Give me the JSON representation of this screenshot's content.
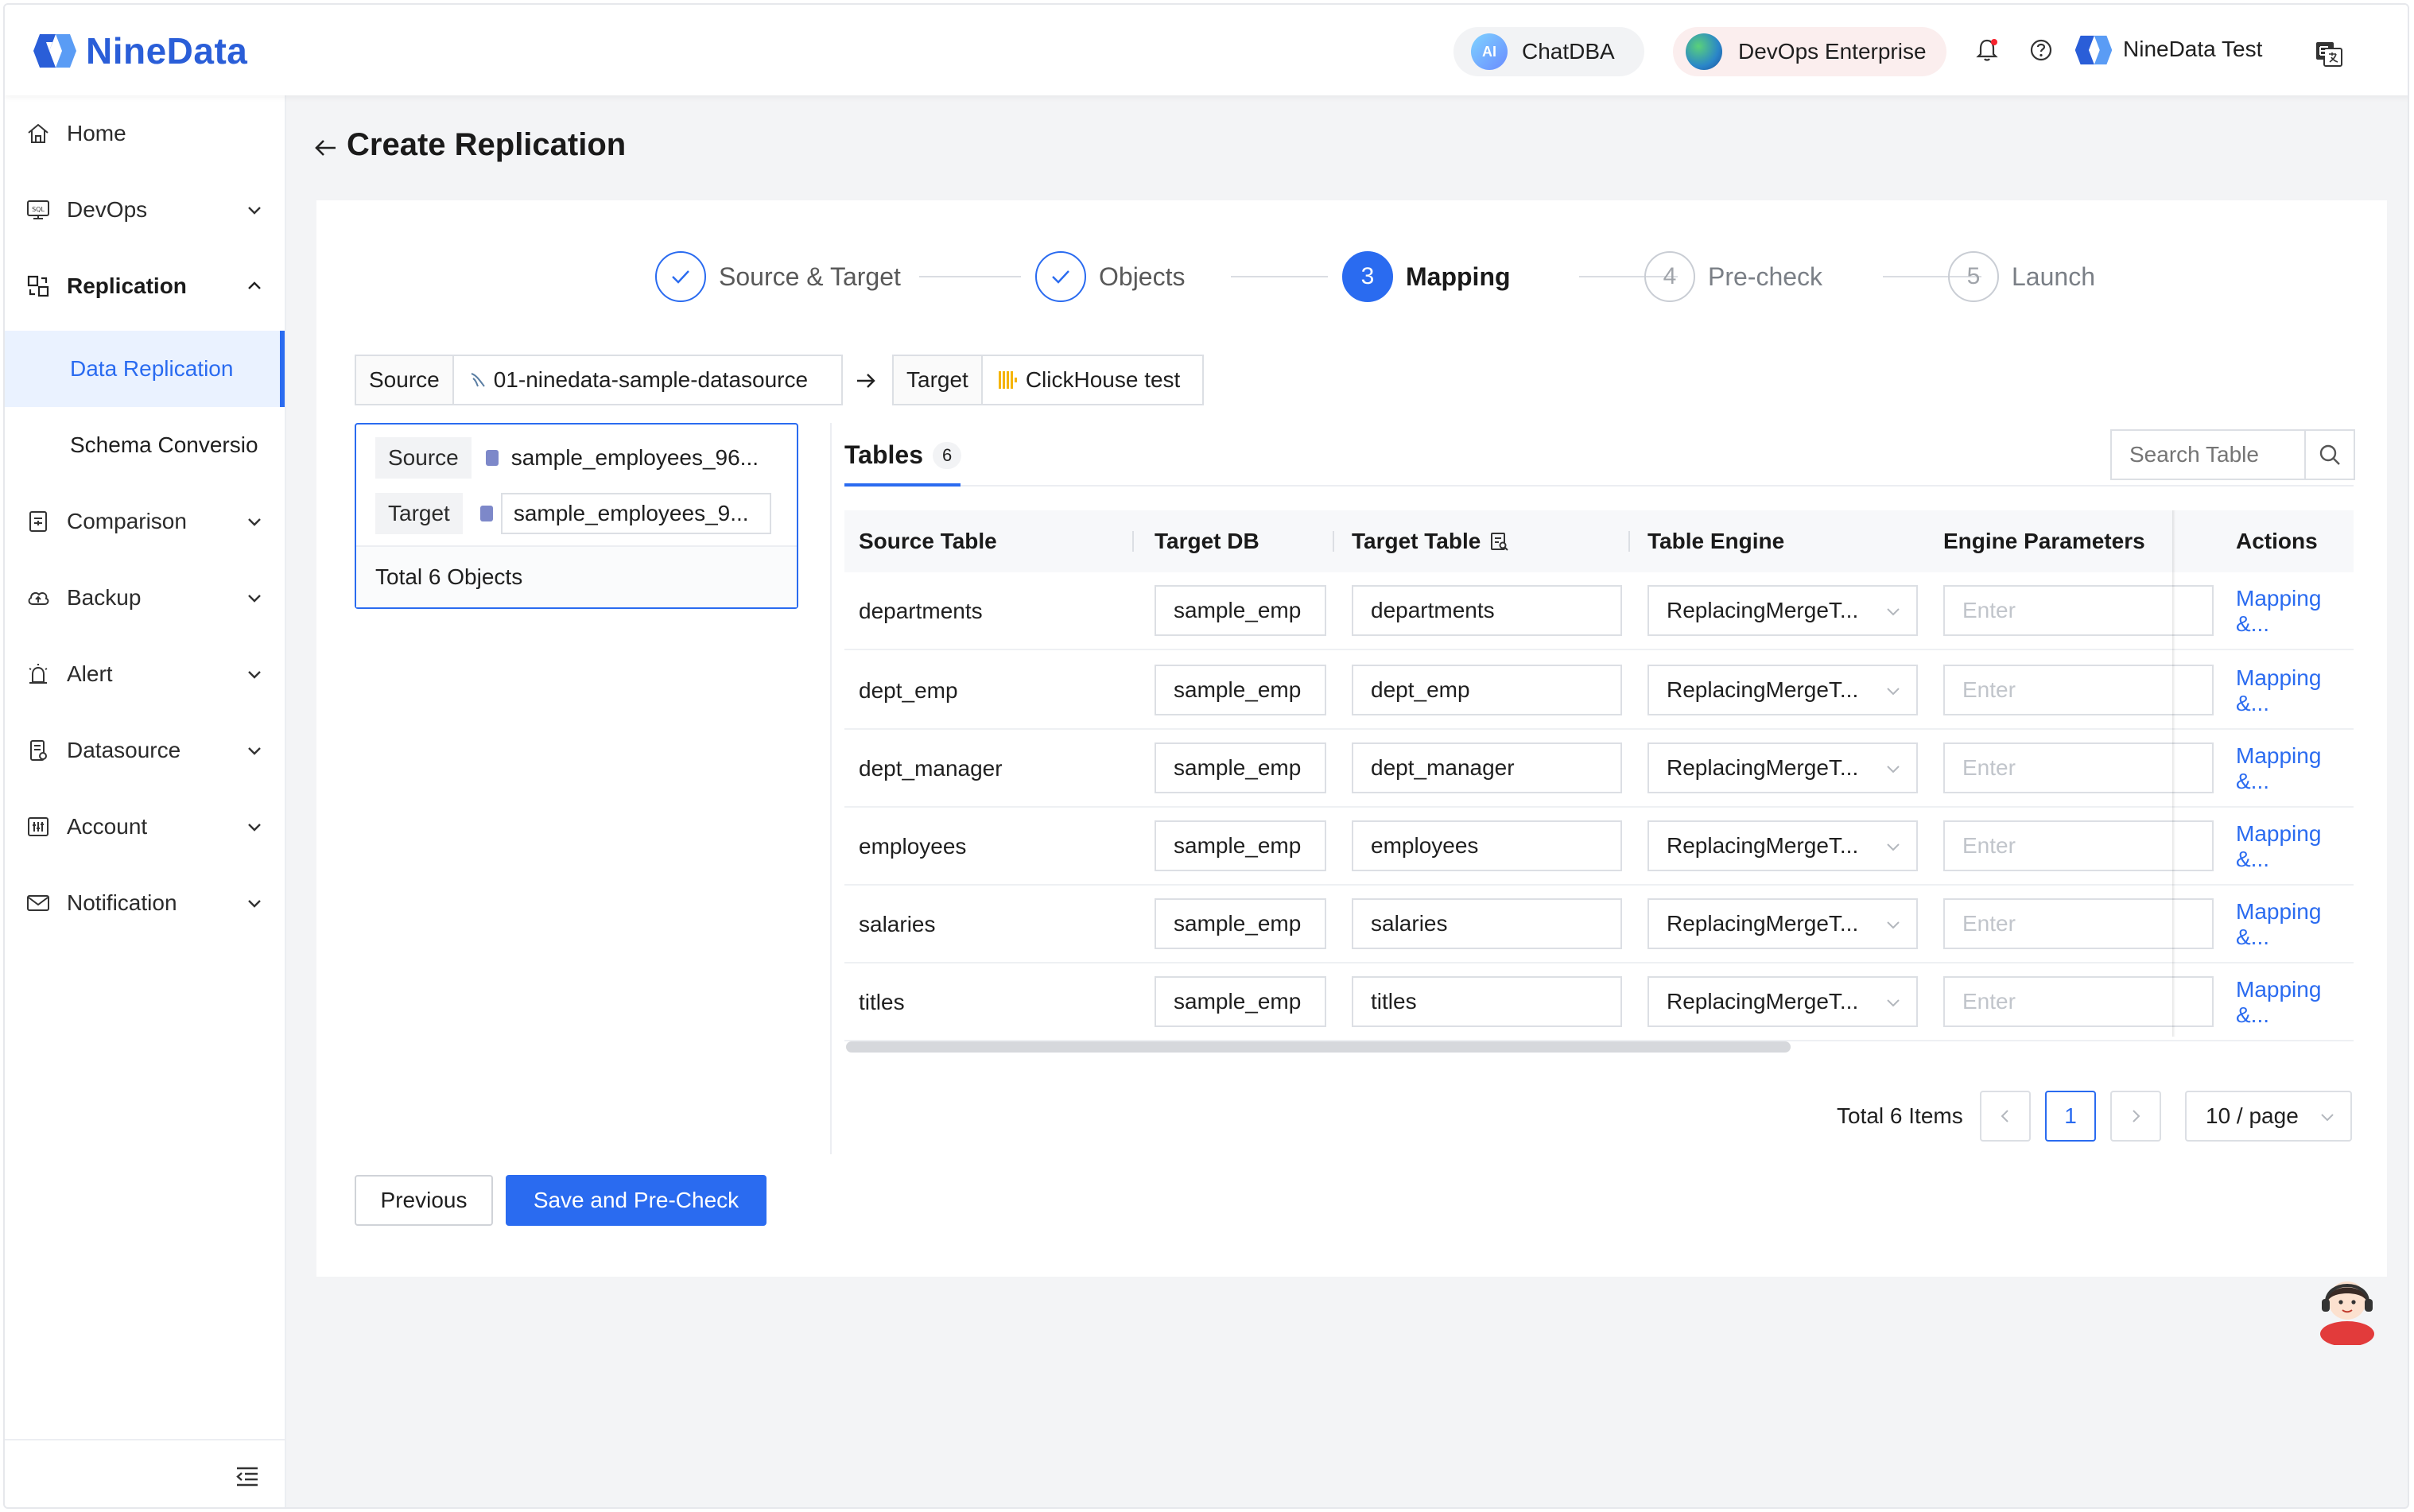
{
  "header": {
    "brand": "NineData",
    "chatdba_label": "ChatDBA",
    "ai_badge": "AI",
    "edition_label": "DevOps Enterprise",
    "user_name": "NineData Test"
  },
  "sidebar": {
    "items": [
      {
        "label": "Home",
        "icon": "home-icon"
      },
      {
        "label": "DevOps",
        "icon": "sql-icon"
      },
      {
        "label": "Replication",
        "icon": "replication-icon"
      },
      {
        "label": "Comparison",
        "icon": "comparison-icon"
      },
      {
        "label": "Backup",
        "icon": "backup-icon"
      },
      {
        "label": "Alert",
        "icon": "alert-icon"
      },
      {
        "label": "Datasource",
        "icon": "datasource-icon"
      },
      {
        "label": "Account",
        "icon": "account-icon"
      },
      {
        "label": "Notification",
        "icon": "mail-icon"
      }
    ],
    "sub_items": [
      "Data Replication",
      "Schema Conversio"
    ]
  },
  "page": {
    "title": "Create Replication"
  },
  "steps": [
    {
      "num": "",
      "label": "Source & Target",
      "state": "done"
    },
    {
      "num": "",
      "label": "Objects",
      "state": "done"
    },
    {
      "num": "3",
      "label": "Mapping",
      "state": "current"
    },
    {
      "num": "4",
      "label": "Pre-check",
      "state": "todo"
    },
    {
      "num": "5",
      "label": "Launch",
      "state": "todo"
    }
  ],
  "source_target": {
    "source_label": "Source",
    "source_value": "01-ninedata-sample-datasource",
    "target_label": "Target",
    "target_value": "ClickHouse test"
  },
  "objects_panel": {
    "source_label": "Source",
    "source_value": "sample_employees_96...",
    "target_label": "Target",
    "target_value": "sample_employees_9...",
    "total": "Total 6 Objects"
  },
  "tables_tab": {
    "label": "Tables",
    "count": "6",
    "search_placeholder": "Search Table"
  },
  "table": {
    "columns": [
      "Source Table",
      "Target DB",
      "Target Table",
      "Table Engine",
      "Engine Parameters",
      "Actions"
    ],
    "rows": [
      {
        "source": "departments",
        "target_db": "sample_emp",
        "target_table": "departments",
        "engine": "ReplacingMergeT...",
        "params_placeholder": "Enter",
        "action": "Mapping &..."
      },
      {
        "source": "dept_emp",
        "target_db": "sample_emp",
        "target_table": "dept_emp",
        "engine": "ReplacingMergeT...",
        "params_placeholder": "Enter",
        "action": "Mapping &..."
      },
      {
        "source": "dept_manager",
        "target_db": "sample_emp",
        "target_table": "dept_manager",
        "engine": "ReplacingMergeT...",
        "params_placeholder": "Enter",
        "action": "Mapping &..."
      },
      {
        "source": "employees",
        "target_db": "sample_emp",
        "target_table": "employees",
        "engine": "ReplacingMergeT...",
        "params_placeholder": "Enter",
        "action": "Mapping &..."
      },
      {
        "source": "salaries",
        "target_db": "sample_emp",
        "target_table": "salaries",
        "engine": "ReplacingMergeT...",
        "params_placeholder": "Enter",
        "action": "Mapping &..."
      },
      {
        "source": "titles",
        "target_db": "sample_emp",
        "target_table": "titles",
        "engine": "ReplacingMergeT...",
        "params_placeholder": "Enter",
        "action": "Mapping &..."
      }
    ]
  },
  "pagination": {
    "total": "Total 6 Items",
    "current_page": "1",
    "page_size": "10 / page"
  },
  "buttons": {
    "previous": "Previous",
    "save": "Save and Pre-Check"
  },
  "colors": {
    "primary": "#2a6bf0",
    "brand": "#2a5ed8"
  }
}
